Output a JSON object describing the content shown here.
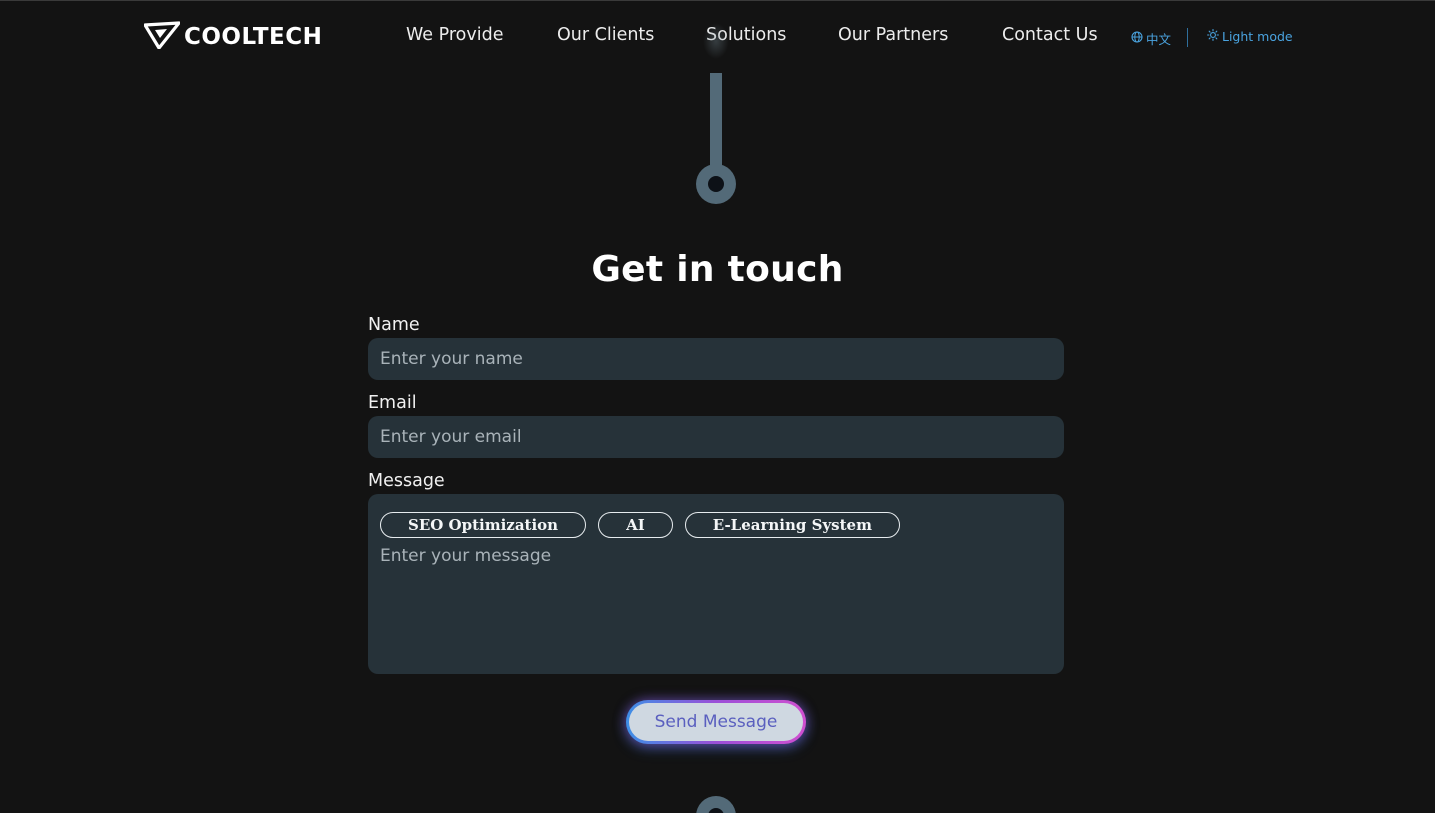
{
  "header": {
    "brand": "COOLTECH",
    "nav": [
      "We Provide",
      "Our Clients",
      "Solutions",
      "Our Partners",
      "Contact Us"
    ],
    "language_label": "中文",
    "theme_label": "Light mode"
  },
  "form": {
    "title": "Get in touch",
    "name_label": "Name",
    "name_placeholder": "Enter your name",
    "email_label": "Email",
    "email_placeholder": "Enter your email",
    "message_label": "Message",
    "message_placeholder": "Enter your message",
    "tags": [
      "SEO Optimization",
      "AI",
      "E-Learning System"
    ],
    "submit_label": "Send Message"
  },
  "colors": {
    "background": "#131313",
    "field_bg": "#263239",
    "accent_blue": "#4aa3df",
    "connector": "#536a78"
  }
}
